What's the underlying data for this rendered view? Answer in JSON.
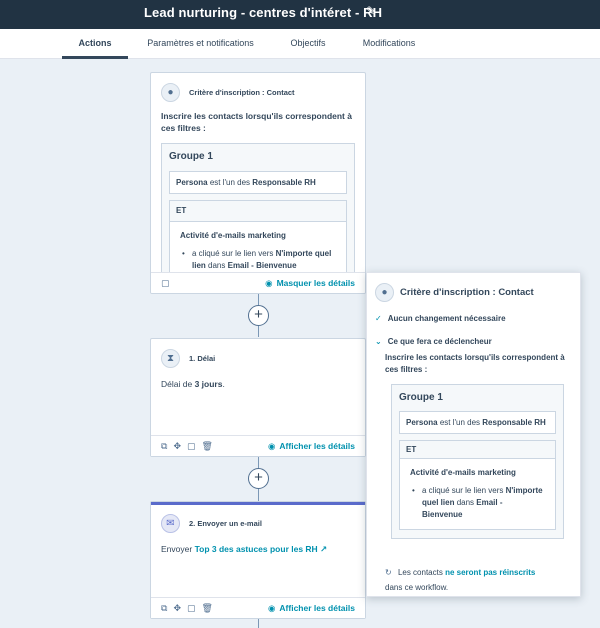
{
  "header": {
    "title": "Lead nurturing - centres d'intéret - RH",
    "edit_icon": "pencil-icon"
  },
  "tabs": [
    {
      "label": "Actions",
      "active": true
    },
    {
      "label": "Paramètres et notifications",
      "active": false
    },
    {
      "label": "Objectifs",
      "active": false
    },
    {
      "label": "Modifications",
      "active": false
    }
  ],
  "trigger_card": {
    "title": "Critère d'inscription : Contact",
    "intro": "Inscrire les contacts lorsqu'ils correspondent à ces filtres :",
    "group_title": "Groupe 1",
    "filter": {
      "property": "Persona",
      "operator": "est l'un des",
      "value": "Responsable RH"
    },
    "and_label": "ET",
    "activity_title": "Activité d'e-mails marketing",
    "bullet_text": "a cliqué sur le lien vers",
    "bullet_link": "N'importe quel lien",
    "bullet_in": "dans",
    "bullet_email": "Email - Bienvenue",
    "footer_link": "Masquer les détails"
  },
  "delay_card": {
    "title": "1. Délai",
    "text_prefix": "Délai de",
    "value": "3 jours",
    "text_suffix": ".",
    "footer_link": "Afficher les détails"
  },
  "email_card": {
    "title": "2. Envoyer un e-mail",
    "text_prefix": "Envoyer",
    "email_link": "Top 3 des astuces pour les RH",
    "footer_link": "Afficher les détails"
  },
  "popover": {
    "title": "Critère d'inscription : Contact",
    "no_change": "Aucun changement nécessaire",
    "what_trigger": "Ce que fera ce déclencheur",
    "intro": "Inscrire les contacts lorsqu'ils correspondent à ces filtres :",
    "group_title": "Groupe 1",
    "filter": {
      "property": "Persona",
      "operator": "est l'un des",
      "value": "Responsable RH"
    },
    "and_label": "ET",
    "activity_title": "Activité d'e-mails marketing",
    "bullet_text": "a cliqué sur le lien vers",
    "bullet_link": "N'importe quel lien",
    "bullet_in": "dans",
    "bullet_email": "Email - Bienvenue",
    "reenroll_prefix": "Les contacts",
    "reenroll_link": "ne seront pas réinscrits",
    "reenroll_suffix": "dans ce workflow."
  },
  "colors": {
    "header_bg": "#213343",
    "link": "#0091ae",
    "email_accent": "#5a6bcb"
  }
}
